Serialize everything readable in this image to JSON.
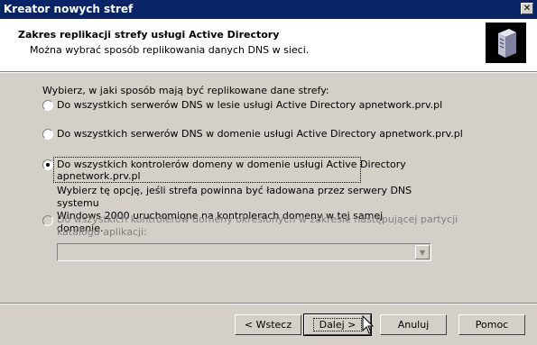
{
  "window": {
    "title": "Kreator nowych stref"
  },
  "header": {
    "title": "Zakres replikacji strefy usługi Active Directory",
    "subtitle": "Można wybrać sposób replikowania danych DNS w sieci.",
    "icon": "server-icon"
  },
  "body": {
    "prompt": "Wybierz, w jaki sposób mają być replikowane dane strefy:",
    "options": [
      {
        "label": "Do wszystkich serwerów DNS w lesie usługi Active Directory apnetwork.prv.pl",
        "checked": false,
        "enabled": true
      },
      {
        "label": "Do wszystkich serwerów DNS w domenie usługi Active Directory apnetwork.prv.pl",
        "checked": false,
        "enabled": true
      },
      {
        "label_line1": "Do wszystkich kontrolerów domeny w domenie usługi Active Directory",
        "label_line2": "apnetwork.prv.pl",
        "checked": true,
        "enabled": true,
        "description_line1": "Wybierz tę opcję, jeśli strefa powinna być ładowana przez serwery DNS systemu",
        "description_line2": "Windows 2000 uruchomione na kontrolerach domeny w tej samej domenie."
      },
      {
        "label_line1": "Do wszystkich kontrolerów domeny określonych w zakresie następującej partycji",
        "label_line2": "katalogu aplikacji:",
        "checked": false,
        "enabled": false
      }
    ],
    "partition_combo": {
      "value": "",
      "enabled": false
    }
  },
  "buttons": {
    "back": "< Wstecz",
    "next": "Dalej >",
    "cancel": "Anuluj",
    "help": "Pomoc"
  }
}
